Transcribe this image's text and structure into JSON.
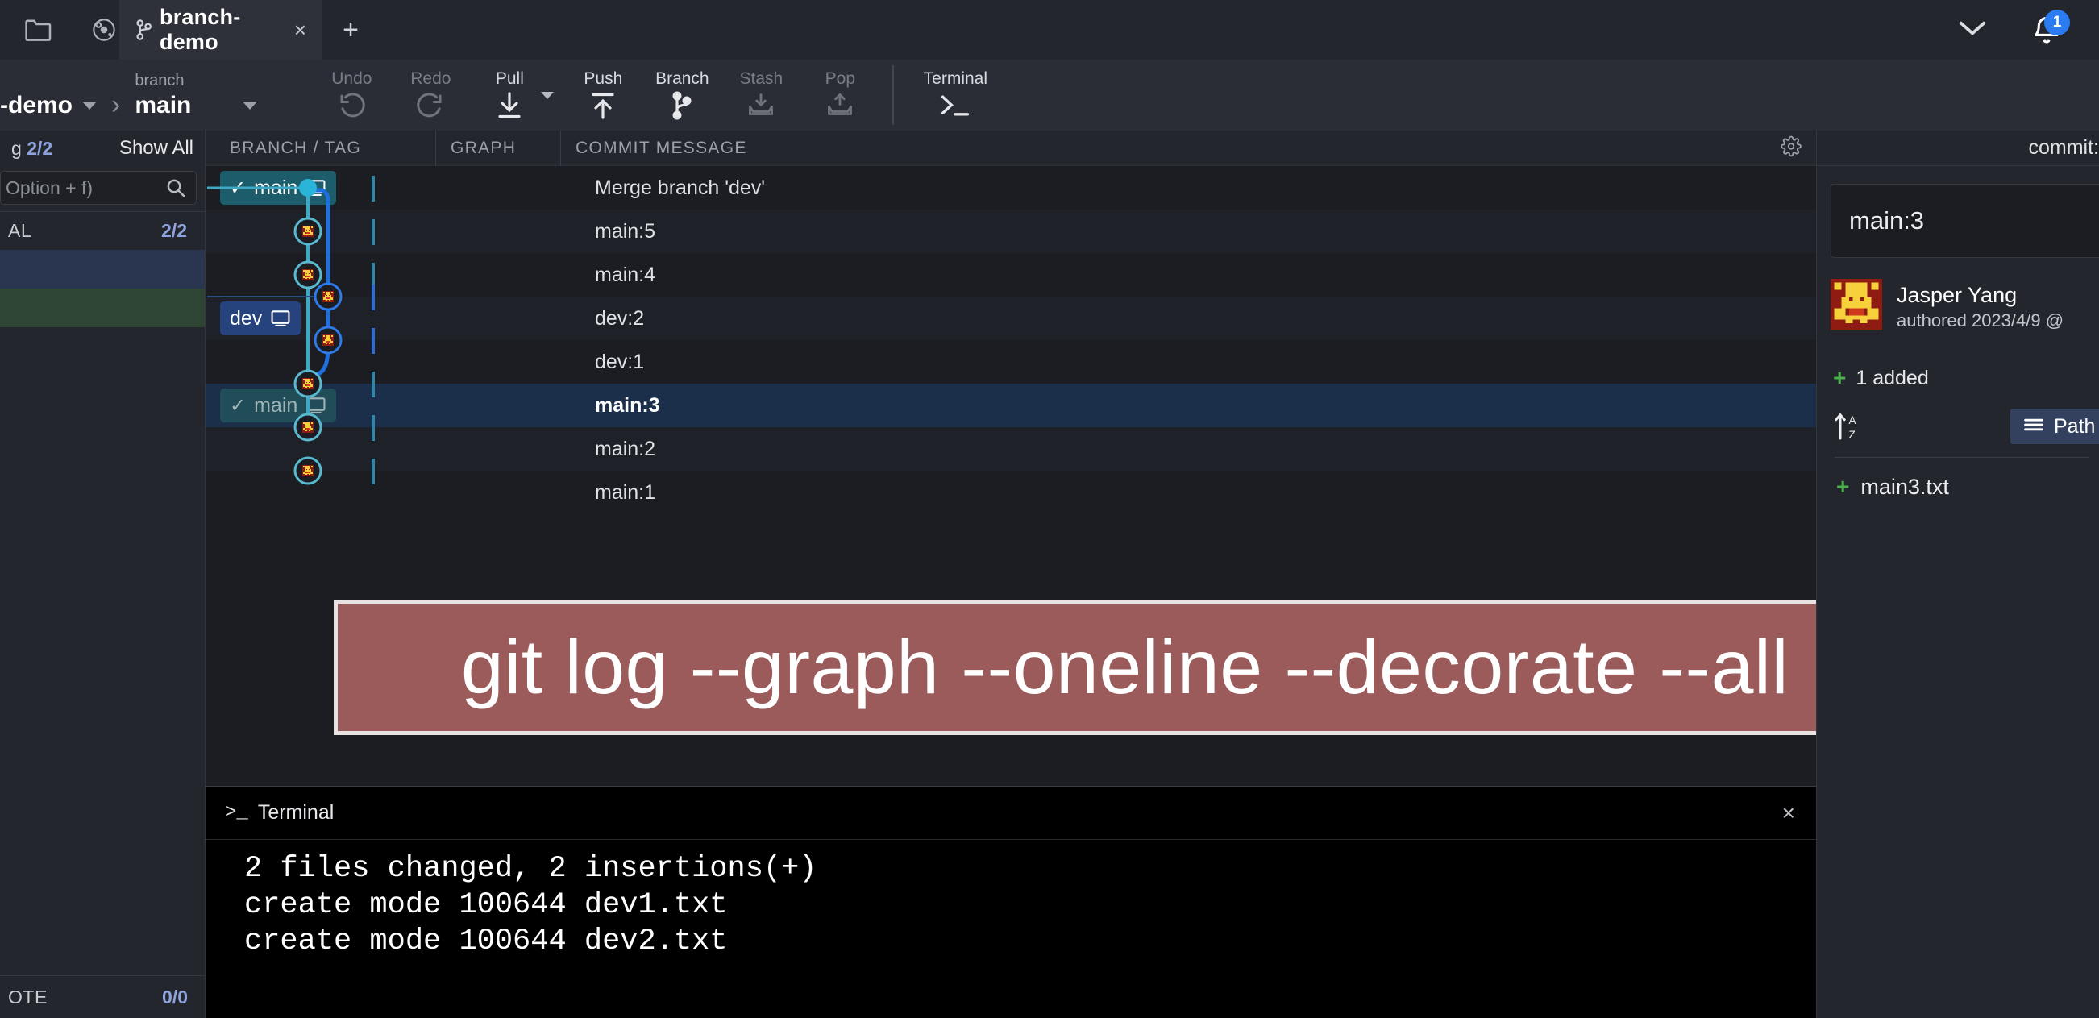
{
  "window": {
    "tabbar": {
      "icons": [
        {
          "name": "folder-icon",
          "label": "folder"
        },
        {
          "name": "atom-icon",
          "label": "atom"
        }
      ],
      "tab": {
        "title": "branch-demo",
        "branch_icon": "branch-icon",
        "close_label": "×"
      },
      "new_tab_label": "+",
      "chevron_label": "chevron-down-icon",
      "notification_count": "1"
    },
    "toolbar": {
      "repo_name": "-demo",
      "branch_caption": "branch",
      "branch_name": "main",
      "actions": [
        {
          "label": "Undo",
          "icon": "undo-icon",
          "disabled": true
        },
        {
          "label": "Redo",
          "icon": "redo-icon",
          "disabled": true
        },
        {
          "label": "Pull",
          "icon": "pull-icon",
          "disabled": false,
          "has_caret": true
        },
        {
          "label": "Push",
          "icon": "push-icon",
          "disabled": false
        },
        {
          "label": "Branch",
          "icon": "branch-fork-icon",
          "disabled": false
        },
        {
          "label": "Stash",
          "icon": "stash-icon",
          "disabled": true
        },
        {
          "label": "Pop",
          "icon": "pop-icon",
          "disabled": true
        }
      ],
      "terminal_action": {
        "label": "Terminal",
        "icon": "terminal-icon"
      }
    }
  },
  "sidebar": {
    "top": {
      "word": "g",
      "count": "2/2",
      "show_all": "Show All"
    },
    "search_placeholder": "Option + f)",
    "section_local": {
      "name": "AL",
      "count": "2/2"
    },
    "section_remote": {
      "name": "OTE",
      "count": "0/0"
    }
  },
  "graph": {
    "columns": [
      "BRANCH / TAG",
      "GRAPH",
      "COMMIT MESSAGE"
    ],
    "gear_icon": "gear-icon",
    "rows": [
      {
        "message": "Merge branch 'dev'",
        "chip": {
          "text": "main",
          "type": "current",
          "check": true,
          "monitor": true
        },
        "selected": false,
        "lane": "main",
        "node": "merge"
      },
      {
        "message": "main:5",
        "chip": null,
        "selected": false,
        "lane": "main",
        "node": "avatar"
      },
      {
        "message": "main:4",
        "chip": null,
        "selected": false,
        "lane": "main",
        "node": "avatar"
      },
      {
        "message": "dev:2",
        "chip": {
          "text": "dev",
          "type": "dev",
          "check": false,
          "monitor": true
        },
        "selected": false,
        "lane": "dev",
        "node": "avatar"
      },
      {
        "message": "dev:1",
        "chip": null,
        "selected": false,
        "lane": "dev",
        "node": "avatar"
      },
      {
        "message": "main:3",
        "chip": {
          "text": "main",
          "type": "current-dim",
          "check": true,
          "monitor": true
        },
        "selected": true,
        "lane": "main",
        "node": "avatar"
      },
      {
        "message": "main:2",
        "chip": null,
        "selected": false,
        "lane": "main",
        "node": "avatar"
      },
      {
        "message": "main:1",
        "chip": null,
        "selected": false,
        "lane": "main",
        "node": "avatar"
      }
    ]
  },
  "callout": {
    "command": "git log --graph --oneline --decorate --all",
    "background": "#9c5b5b",
    "border": "#e8e3e3"
  },
  "terminal": {
    "title": "Terminal",
    "prompt_icon": ">_",
    "close_label": "×",
    "lines": [
      "2 files changed, 2 insertions(+)",
      "create mode 100644 dev1.txt",
      "create mode 100644 dev2.txt"
    ]
  },
  "commit_panel": {
    "header_label": "commit:",
    "message": "main:3",
    "author_name": "Jasper Yang",
    "authored": "authored 2023/4/9 @",
    "added_summary": "1 added",
    "sort_icon": "sort-az-icon",
    "path_button": "Path",
    "files": [
      {
        "status": "+",
        "name": "main3.txt"
      }
    ]
  }
}
